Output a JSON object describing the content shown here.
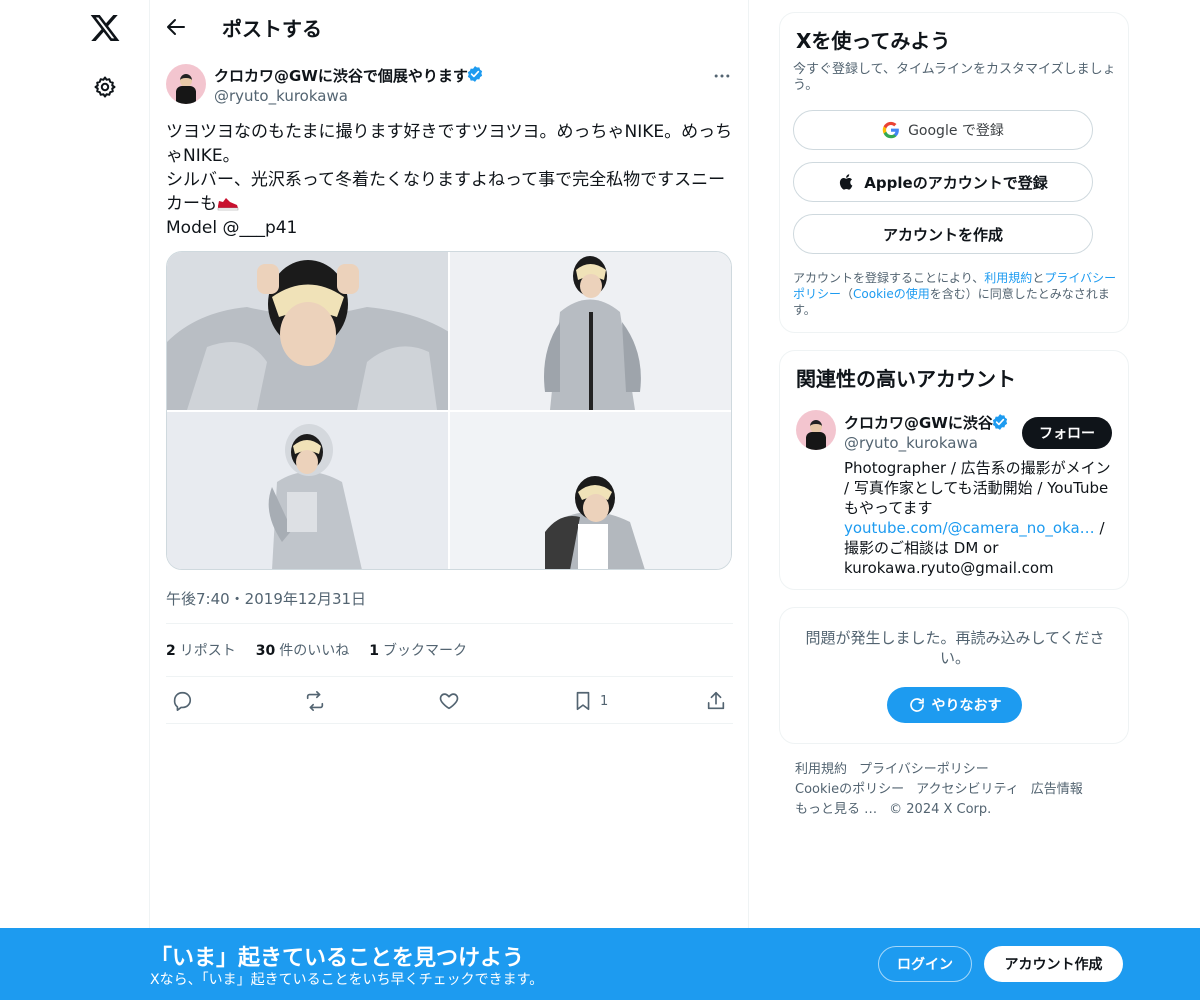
{
  "header": {
    "title": "ポストする"
  },
  "post": {
    "author_name": "クロカワ@GWに渋谷で個展やります",
    "author_handle": "@ryuto_kurokawa",
    "text_line1": "ツヨツヨなのもたまに撮ります好きですツヨツヨ。めっちゃNIKE。めっちゃNIKE。",
    "text_line2": "シルバー、光沢系って冬着たくなりますよねって事で完全私物ですスニーカーも",
    "text_line3": "Model @___p41",
    "emoji_icon": "sneaker-icon",
    "timestamp": "午後7:40・2019年12月31日",
    "stats": {
      "reposts_count": "2",
      "reposts_label": "リポスト",
      "likes_count": "30",
      "likes_label": "件のいいね",
      "bookmarks_count": "1",
      "bookmarks_label": "ブックマーク"
    },
    "actions": {
      "bookmark_count": "1"
    }
  },
  "signup_card": {
    "title": "Xを使ってみよう",
    "description": "今すぐ登録して、タイムラインをカスタマイズしましょう。",
    "google_label": "Google で登録",
    "apple_label": "Appleのアカウントで登録",
    "create_label": "アカウントを作成",
    "terms_prefix": "アカウントを登録することにより、",
    "terms_link": "利用規約",
    "terms_and": "と",
    "privacy_link": "プライバシーポリシー",
    "terms_mid": "（",
    "cookie_link": "Cookieの使用",
    "terms_suffix": "を含む）に同意したとみなされます。"
  },
  "recommended": {
    "title": "関連性の高いアカウント",
    "name": "クロカワ@GWに渋谷",
    "handle": "@ryuto_kurokawa",
    "follow_label": "フォロー",
    "bio_part1": "Photographer / 広告系の撮影がメイン / 写真作家としても活動開始 / YouTubeもやってます ",
    "bio_link": "youtube.com/@camera_no_oka…",
    "bio_part2": " / 撮影のご相談は DM or kurokawa.ryuto@gmail.com"
  },
  "error_card": {
    "message": "問題が発生しました。再読み込みしてください。",
    "retry_label": "やりなおす"
  },
  "footer": {
    "terms": "利用規約",
    "privacy": "プライバシーポリシー",
    "cookie": "Cookieのポリシー",
    "accessibility": "アクセシビリティ",
    "ads": "広告情報",
    "more": "もっと見る …",
    "copyright": "© 2024 X Corp."
  },
  "bottom_bar": {
    "title": "「いま」起きていることを見つけよう",
    "subtitle": "Xなら、「いま」起きていることをいち早くチェックできます。",
    "login_label": "ログイン",
    "signup_label": "アカウント作成"
  },
  "colors": {
    "accent": "#1d9bf0",
    "text": "#0f1419",
    "secondary": "#536471",
    "border": "#eff3f4"
  }
}
